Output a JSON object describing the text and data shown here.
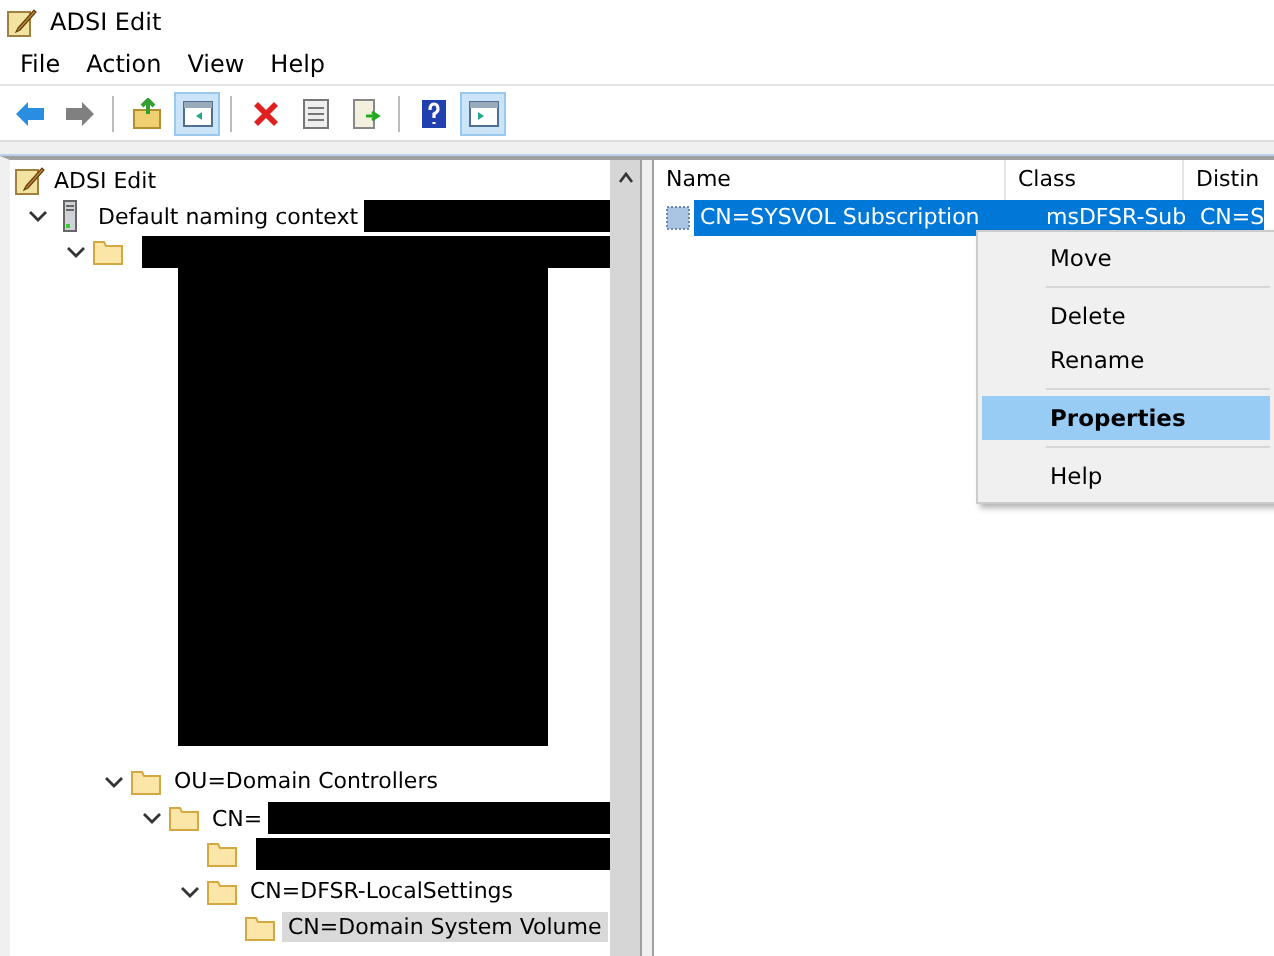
{
  "window": {
    "title": "ADSI Edit"
  },
  "menu": [
    "File",
    "Action",
    "View",
    "Help"
  ],
  "toolbar": [
    {
      "kind": "back",
      "pressed": false
    },
    {
      "kind": "forward",
      "pressed": false
    },
    {
      "kind": "sep"
    },
    {
      "kind": "up",
      "pressed": false
    },
    {
      "kind": "pane",
      "pressed": true
    },
    {
      "kind": "sep"
    },
    {
      "kind": "delete",
      "pressed": false
    },
    {
      "kind": "props",
      "pressed": false
    },
    {
      "kind": "export",
      "pressed": false
    },
    {
      "kind": "sep"
    },
    {
      "kind": "help",
      "pressed": false
    },
    {
      "kind": "pane2",
      "pressed": true
    }
  ],
  "tree": {
    "label": "ADSI Edit",
    "children": [
      {
        "label": "Default naming context",
        "kind": "server",
        "expanded": true,
        "selected": false,
        "redacted": true,
        "children": [
          {
            "kind": "folder",
            "expanded": true,
            "selected": false,
            "redacted": true,
            "children": [
              {
                "kind": "hidden"
              },
              {
                "label": "OU=Domain Controllers",
                "kind": "folder",
                "expanded": true,
                "selected": false,
                "children": [
                  {
                    "label": "CN=",
                    "kind": "folder",
                    "expanded": true,
                    "selected": false,
                    "redacted": true,
                    "children": [
                      {
                        "kind": "folder",
                        "selected": false,
                        "redacted": true
                      },
                      {
                        "label": "CN=DFSR-LocalSettings",
                        "kind": "folder",
                        "expanded": true,
                        "selected": false,
                        "children": [
                          {
                            "label": "CN=Domain System Volume",
                            "kind": "folder",
                            "selected": true
                          }
                        ]
                      }
                    ]
                  }
                ]
              }
            ]
          }
        ]
      }
    ]
  },
  "list": {
    "columns": [
      "Name",
      "Class",
      "Distin"
    ],
    "rows": [
      {
        "cells": [
          "CN=SYSVOL Subscription",
          "msDFSR-Sub",
          "CN=S"
        ],
        "selected": true
      }
    ]
  },
  "context_menu": [
    {
      "label": "Move",
      "kind": "item",
      "selected": false
    },
    {
      "kind": "sep"
    },
    {
      "label": "Delete",
      "kind": "item",
      "selected": false
    },
    {
      "label": "Rename",
      "kind": "item",
      "selected": false
    },
    {
      "kind": "sep"
    },
    {
      "label": "Properties",
      "kind": "item",
      "selected": true
    },
    {
      "kind": "sep"
    },
    {
      "label": "Help",
      "kind": "item",
      "selected": false
    }
  ]
}
